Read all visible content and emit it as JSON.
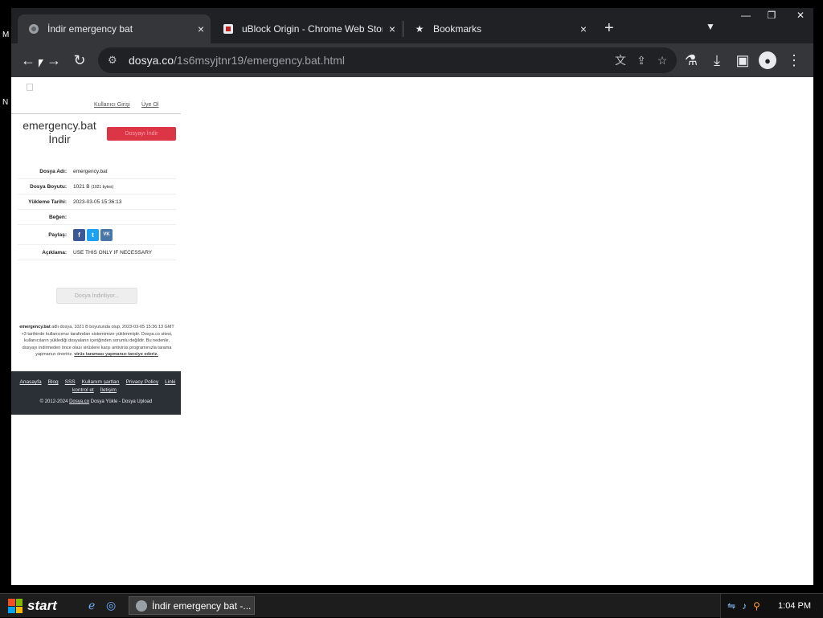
{
  "desktop": {
    "fragments": [
      "M",
      "N"
    ]
  },
  "browser": {
    "tabs": [
      {
        "title": "İndir emergency bat",
        "favicon": "globe-icon",
        "active": true
      },
      {
        "title": "uBlock Origin - Chrome Web Store",
        "favicon": "ublock-icon",
        "active": false
      },
      {
        "title": "Bookmarks",
        "favicon": "star-icon",
        "active": false
      }
    ],
    "close_glyph": "×",
    "new_tab_glyph": "+",
    "url_host": "dosya.co",
    "url_path": "/1s6msyjtnr19/emergency.bat.html"
  },
  "page": {
    "top_links": [
      "Kullanıcı Girişi",
      "Üye Ol"
    ],
    "file_title_line1": "emergency.bat",
    "file_title_line2": "İndir",
    "top_download_button": "Dosyayı İndir",
    "info": {
      "name_label": "Dosya Adı:",
      "name_value": "emergency.bat",
      "size_label": "Dosya Boyutu:",
      "size_value": "1021 B",
      "size_bytes": "(1021 bytes)",
      "date_label": "Yükleme Tarihi:",
      "date_value": "2023-03-05 15:36:13",
      "like_label": "Beğen:",
      "share_label": "Paylaş:",
      "desc_label": "Açıklama:",
      "desc_value": "USE THIS ONLY IF NECESSARY"
    },
    "share_buttons": [
      {
        "label": "f",
        "color": "#3b5998"
      },
      {
        "label": "t",
        "color": "#1da1f2"
      },
      {
        "label": "VK",
        "color": "#4a76a8"
      }
    ],
    "main_download_button": "Dosya İndiriliyor...",
    "about": {
      "bold_name": "emergency.bat",
      "text": " adlı dosya, 1021 B boyutunda olup, 2023-03-05 15:36:13 GMT +3 tarihinde kullanıcımız tarafından sistemimize yüklenmiştir. Dosya.co sitesi, kullanıcıların yüklediği dosyaların içeriğinden sorumlu değildir. Bu nedenle, dosyayı indirmeden önce olası virüslere karşı antivirüs programınızla tarama yapmanızı öneririz.",
      "link": "virüs taraması yapmanızı tavsiye ederiz."
    },
    "footer": {
      "links": [
        "Anasayfa",
        "Blog",
        "SSS",
        "Kullanım şartları",
        "Privacy Policy",
        "Linki kontrol et",
        "İletişim"
      ],
      "copyright_prefix": "© 2012-2024",
      "copyright_link": "Dosya.co",
      "copyright_suffix": "Dosya Yükle - Dosya Upload"
    }
  },
  "taskbar": {
    "start_label": "start",
    "task_title": "İndir emergency bat -...",
    "clock": "1:04 PM"
  }
}
